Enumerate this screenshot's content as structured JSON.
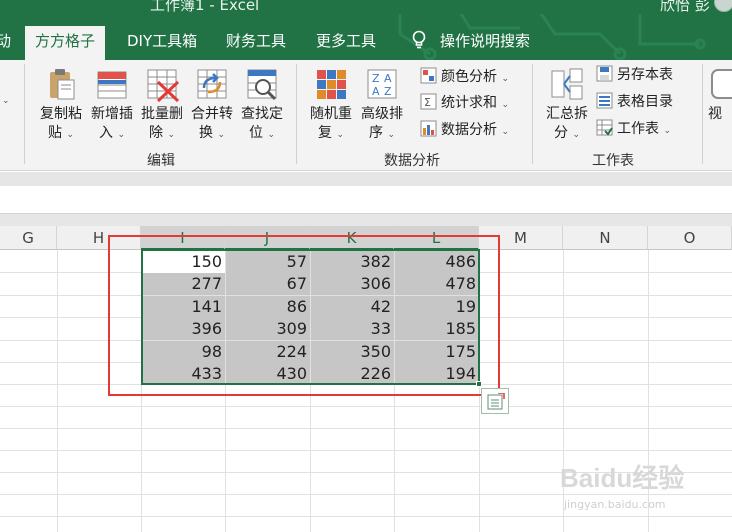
{
  "window": {
    "title": "工作簿1  -  Excel",
    "user_name": "欣怡 彭"
  },
  "tabs": [
    {
      "label": "动"
    },
    {
      "label": "方方格子"
    },
    {
      "label": "DIY工具箱"
    },
    {
      "label": "财务工具"
    },
    {
      "label": "更多工具"
    },
    {
      "label": "操作说明搜索"
    }
  ],
  "ribbon": {
    "big_buttons": [
      {
        "line1": "复制粘",
        "line2": "贴"
      },
      {
        "line1": "新增插",
        "line2": "入"
      },
      {
        "line1": "批量删",
        "line2": "除"
      },
      {
        "line1": "合并转",
        "line2": "换"
      },
      {
        "line1": "查找定",
        "line2": "位"
      },
      {
        "line1": "随机重",
        "line2": "复"
      },
      {
        "line1": "高级排",
        "line2": "序"
      },
      {
        "line1": "汇总拆",
        "line2": "分"
      },
      {
        "line1": "视",
        "line2": ""
      }
    ],
    "small_buttons": [
      {
        "label": "颜色分析"
      },
      {
        "label": "统计求和"
      },
      {
        "label": "数据分析"
      },
      {
        "label": "另存本表"
      },
      {
        "label": "表格目录"
      },
      {
        "label": "工作表"
      }
    ],
    "groups": [
      {
        "label": "编辑"
      },
      {
        "label": "数据分析"
      },
      {
        "label": "工作表"
      }
    ],
    "caret": "⌄"
  },
  "columns": [
    "G",
    "H",
    "I",
    "J",
    "K",
    "L",
    "M",
    "N",
    "O"
  ],
  "selected_range": {
    "columns": [
      "I",
      "J",
      "K",
      "L"
    ]
  },
  "table_rows": [
    [
      150,
      57,
      382,
      486
    ],
    [
      277,
      67,
      306,
      478
    ],
    [
      141,
      86,
      42,
      19
    ],
    [
      396,
      309,
      33,
      185
    ],
    [
      98,
      224,
      350,
      175
    ],
    [
      433,
      430,
      226,
      194
    ]
  ],
  "colors": {
    "accent": "#217346",
    "highlight_box": "#e53935",
    "selection_fill": "#c6c6c6"
  },
  "watermark": {
    "brand": "Baidu经验",
    "url": "jingyan.baidu.com"
  }
}
